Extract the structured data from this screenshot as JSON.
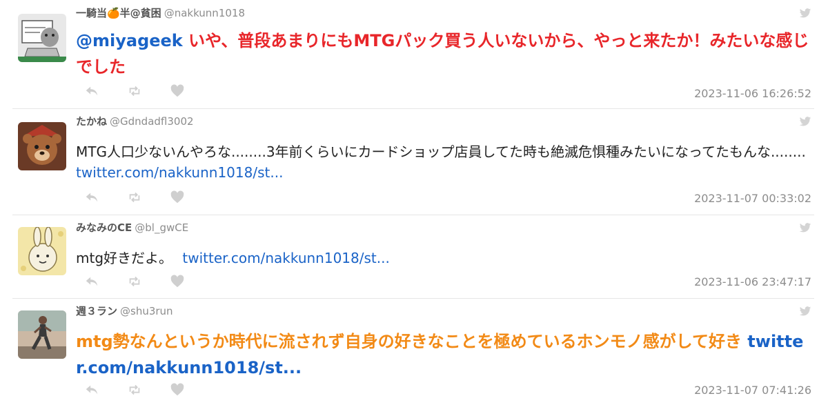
{
  "tweets": [
    {
      "name": "一騎当🍊半@貧困",
      "handle": "@nakkunn1018",
      "mention": "@miyageek",
      "text": "いや、普段あまりにもMTGパック買う人いないから、やっと来たか！みたいな感じでした",
      "timestamp": "2023-11-06 16:26:52"
    },
    {
      "name": "たかね",
      "handle": "@Gdndadfl3002",
      "text": "MTG人口少ないんやろな........3年前くらいにカードショップ店員してた時も絶滅危惧種みたいになってたもんな........",
      "link": "twitter.com/nakkunn1018/st...",
      "timestamp": "2023-11-07 00:33:02"
    },
    {
      "name": "みなみのCE",
      "handle": "@bl_gwCE",
      "text": "mtg好きだよ。",
      "link": "twitter.com/nakkunn1018/st...",
      "timestamp": "2023-11-06 23:47:17"
    },
    {
      "name": "週３ラン",
      "handle": "@shu3run",
      "text": "mtg勢なんというか時代に流されず自身の好きなことを極めているホンモノ感がして好き",
      "link": "twitter.com/nakkunn1018/st...",
      "timestamp": "2023-11-07 07:41:26"
    }
  ],
  "icons": {
    "bird": "twitter-bird-icon",
    "reply": "reply-icon",
    "retweet": "retweet-icon",
    "like": "heart-icon"
  },
  "colors": {
    "mention": "#1a63c7",
    "highlight_red": "#e8262a",
    "highlight_orange": "#f28a16",
    "icon_gray": "#cfcfcf",
    "timestamp": "#8c8c8c"
  }
}
